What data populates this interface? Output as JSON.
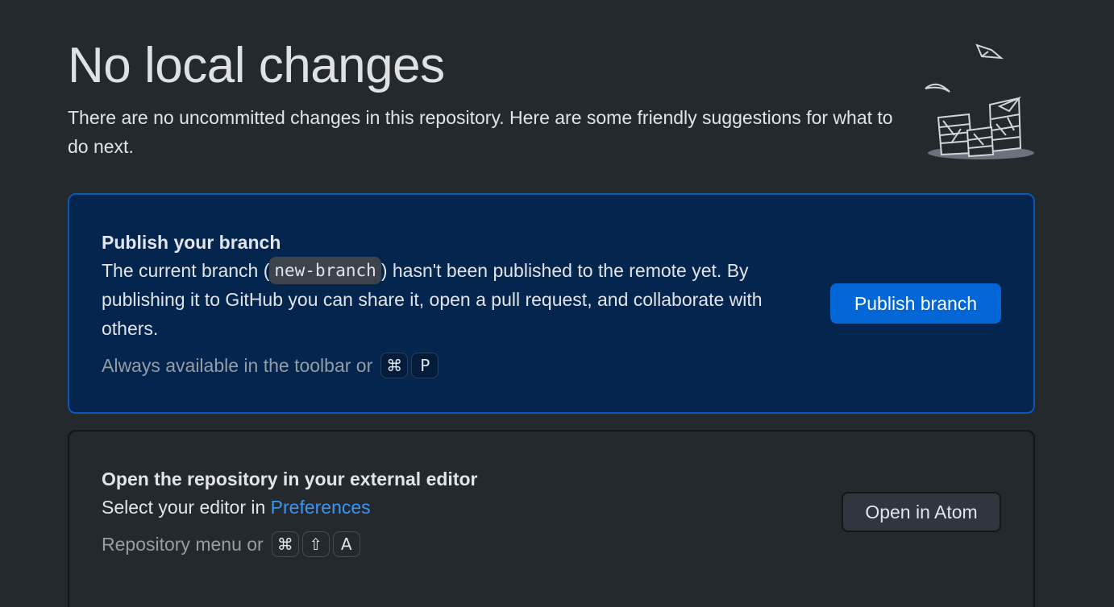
{
  "header": {
    "title": "No local changes",
    "description": "There are no uncommitted changes in this repository. Here are some friendly suggestions for what to do next."
  },
  "publish": {
    "title": "Publish your branch",
    "desc_before": "The current branch (",
    "branch": "new-branch",
    "desc_after": ") hasn't been published to the remote yet. By publishing it to GitHub you can share it, open a pull request, and collaborate with others.",
    "hint": "Always available in the toolbar or",
    "keys": [
      "⌘",
      "P"
    ],
    "button_label": "Publish branch"
  },
  "editor": {
    "title": "Open the repository in your external editor",
    "desc_before": "Select your editor in",
    "link": "Preferences",
    "hint": "Repository menu or",
    "keys": [
      "⌘",
      "⇧",
      "A"
    ],
    "button_label": "Open in Atom"
  },
  "colors": {
    "background": "#24292e",
    "publish_card_bg": "#04254e",
    "publish_card_border": "#0b59b8",
    "primary_button": "#0366d6",
    "link": "#3a95f3"
  }
}
